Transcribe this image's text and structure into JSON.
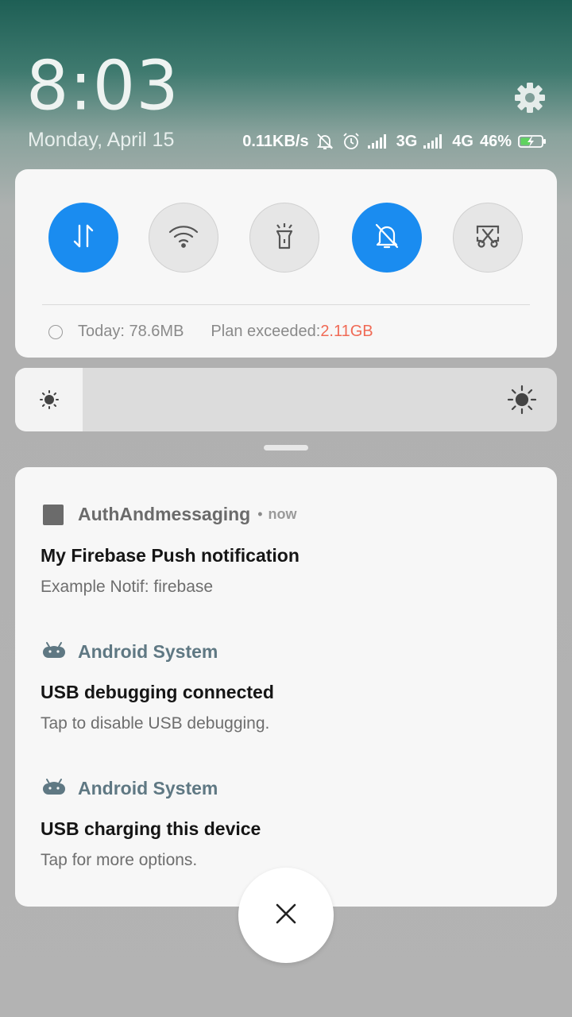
{
  "header": {
    "time": "8:03",
    "date": "Monday, April 15",
    "settings_icon": "gear-icon"
  },
  "status_bar": {
    "net_speed": "0.11KB/s",
    "network1": "3G",
    "network2": "4G",
    "battery": "46%",
    "battery_level": 0.46,
    "icons": [
      "bell-off-icon",
      "alarm-icon",
      "signal-icon",
      "signal-icon",
      "battery-charging-icon"
    ]
  },
  "quick_settings": {
    "toggles": [
      {
        "name": "mobile-data",
        "icon": "data-arrows-icon",
        "on": true
      },
      {
        "name": "wifi",
        "icon": "wifi-icon",
        "on": false
      },
      {
        "name": "flashlight",
        "icon": "flashlight-icon",
        "on": false
      },
      {
        "name": "silent",
        "icon": "bell-off-icon",
        "on": true
      },
      {
        "name": "screenshot",
        "icon": "scissors-icon",
        "on": false
      }
    ],
    "usage_today": "Today: 78.6MB",
    "plan_label": "Plan exceeded: ",
    "plan_value": "2.11GB"
  },
  "brightness": {
    "level": 0.125
  },
  "notifications": [
    {
      "app": "AuthAndmessaging",
      "time": "now",
      "title": "My Firebase Push notification",
      "text": "Example Notif: firebase"
    },
    {
      "app": "Android System",
      "title": "USB debugging connected",
      "text": "Tap to disable USB debugging."
    },
    {
      "app": "Android System",
      "title": "USB charging this device",
      "text": "Tap for more options."
    }
  ],
  "colors": {
    "accent": "#1a8cf0",
    "warning": "#f06a55",
    "android_app": "#5f7883",
    "generic_app": "#6b6b6b"
  }
}
